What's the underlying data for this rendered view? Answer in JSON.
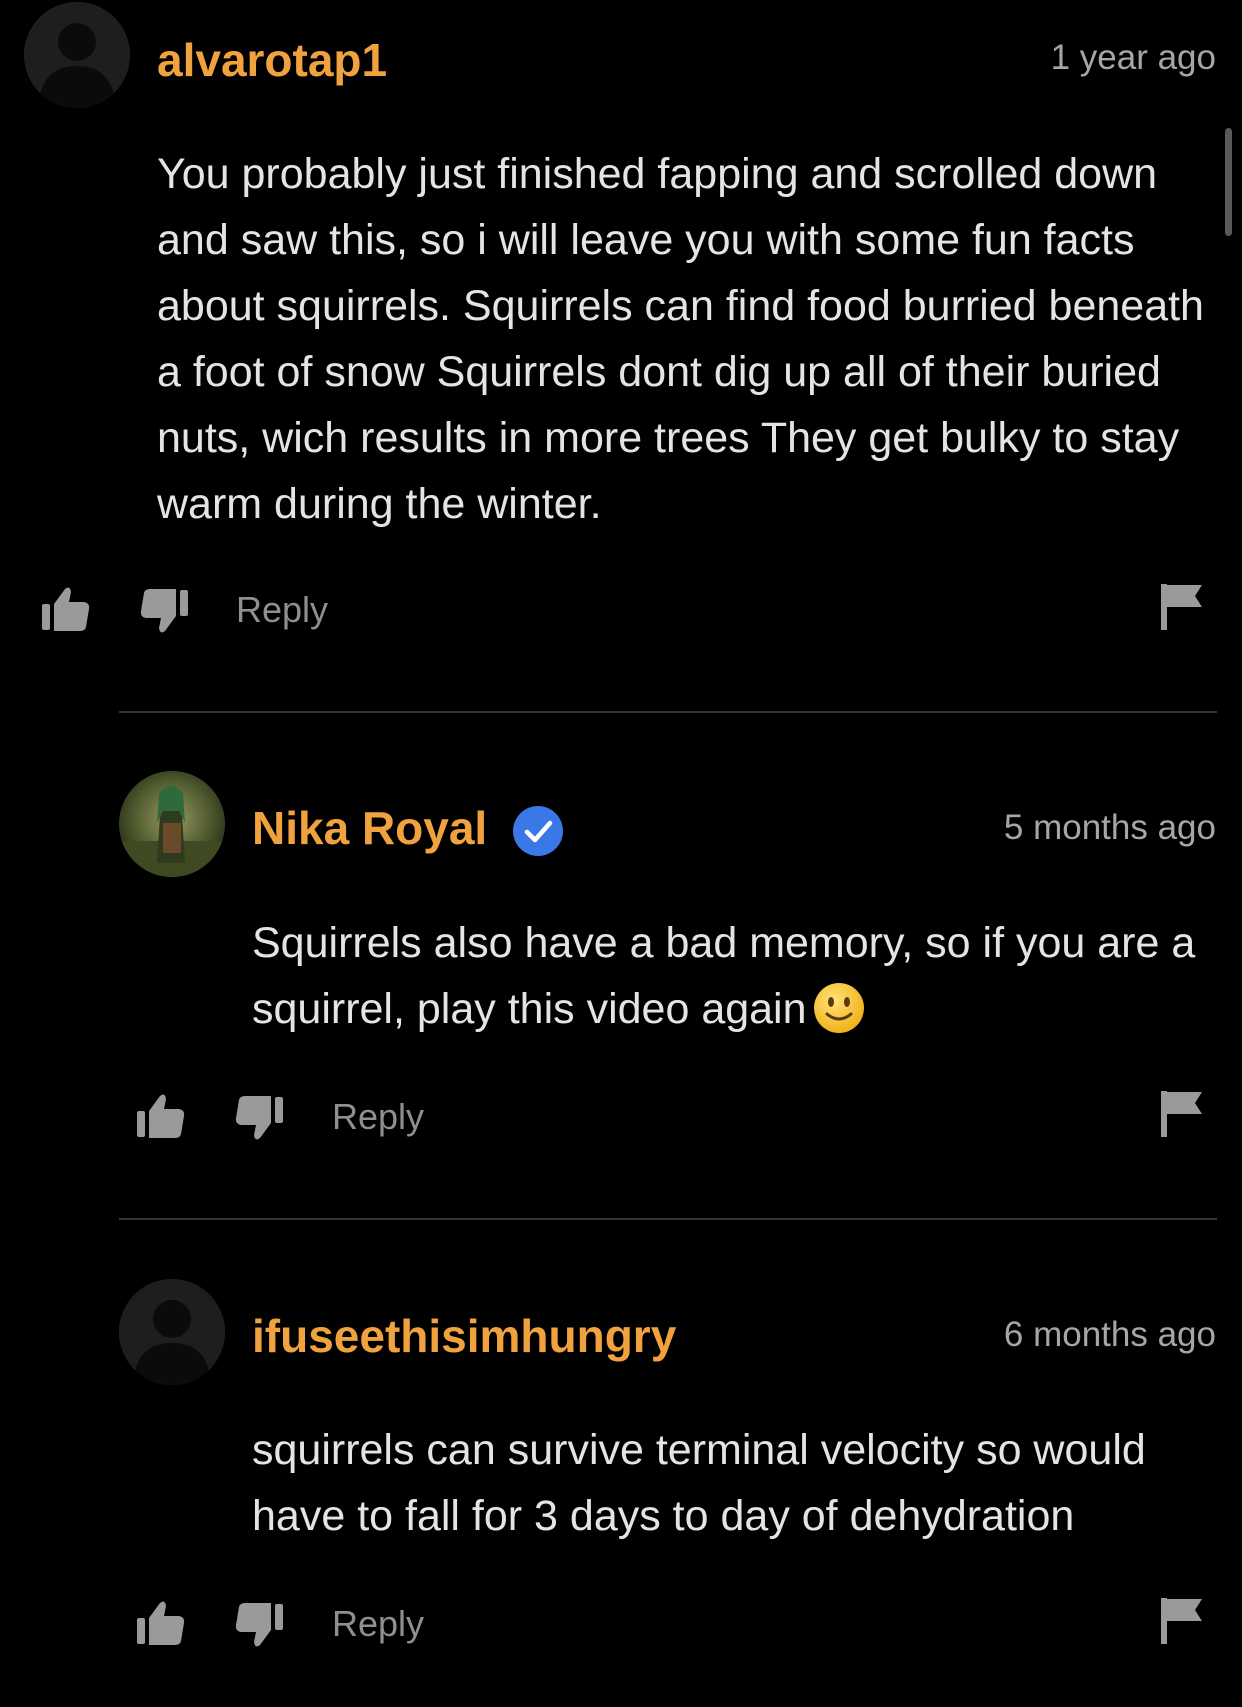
{
  "theme": {
    "username_color": "#f0a23e",
    "verified_color": "#3b78e7",
    "icon_color": "#9a9a9a",
    "background": "#000000"
  },
  "comments": [
    {
      "username": "alvarotap1",
      "timestamp": "1 year ago",
      "avatar": "default-user-silhouette",
      "verified": false,
      "text": "You probably just finished fapping and scrolled down and saw this, so i will leave you with some fun facts about squirrels. Squirrels can find food burried beneath a foot of snow Squirrels dont dig up all of their buried nuts, wich results in more trees They get bulky to stay warm during the winter.",
      "reply_label": "Reply"
    },
    {
      "username": "Nika Royal",
      "timestamp": "5 months ago",
      "avatar": "profile-photo",
      "verified": true,
      "text": "Squirrels also have a bad memory, so if you are a squirrel, play this video again",
      "emoji": "slightly-smiling-face",
      "reply_label": "Reply"
    },
    {
      "username": "ifuseethisimhungry",
      "timestamp": "6 months ago",
      "avatar": "default-user-silhouette",
      "verified": false,
      "text": "squirrels can survive terminal velocity so would have to fall for 3 days to day of dehydration",
      "reply_label": "Reply"
    }
  ]
}
